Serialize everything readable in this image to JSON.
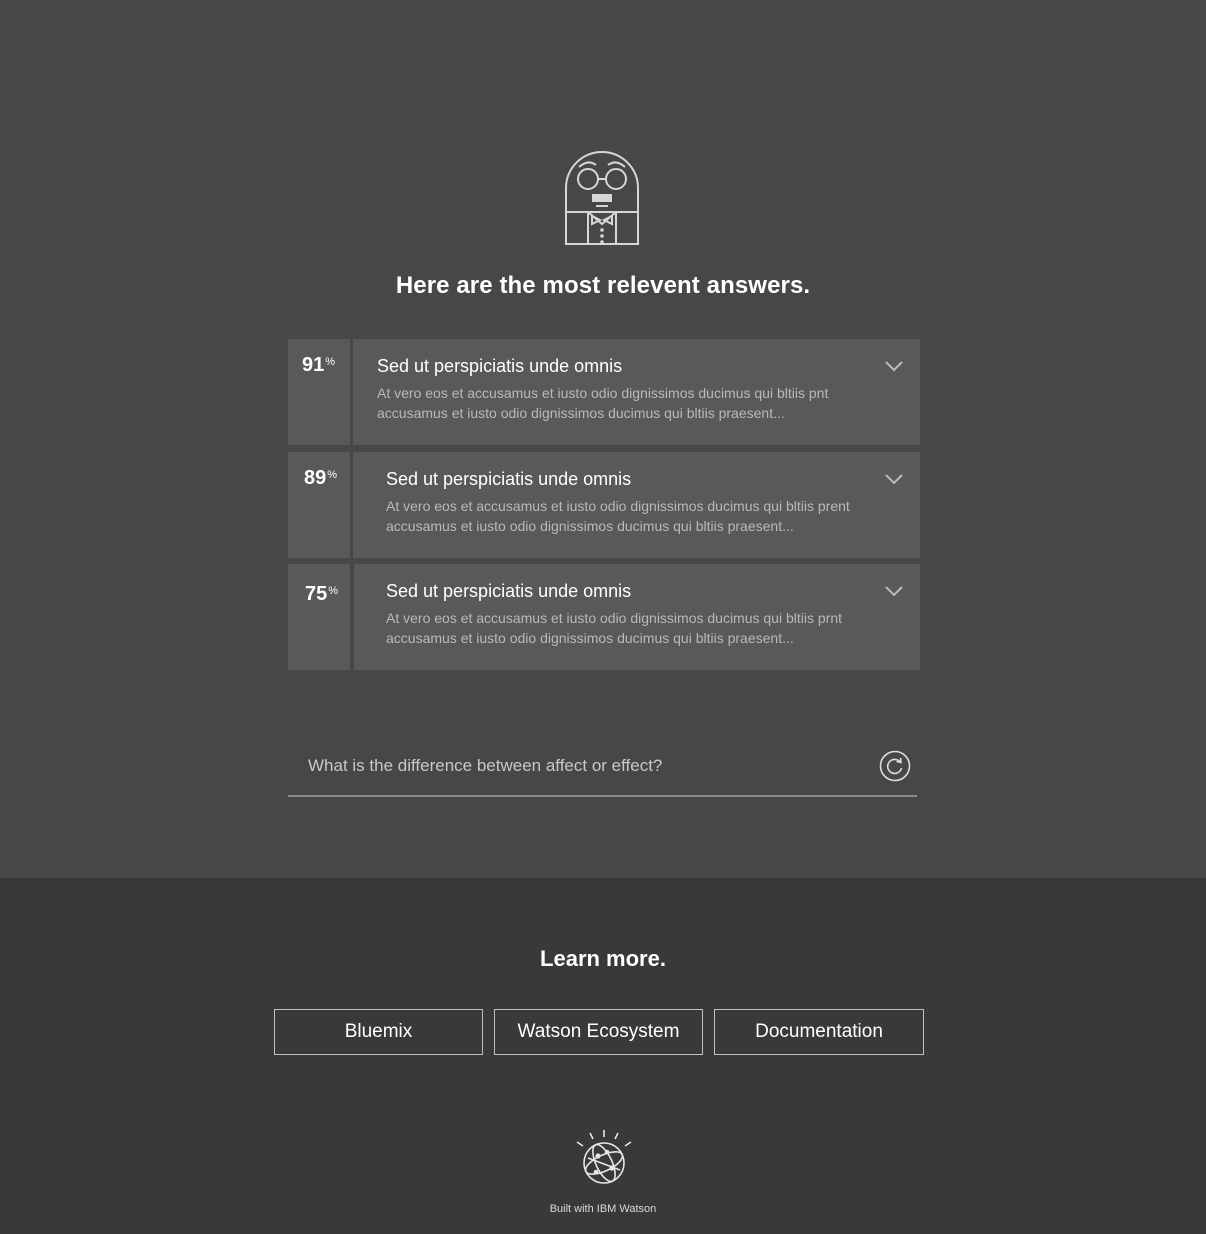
{
  "header": {
    "mascot_icon": "robot-butler-icon",
    "headline": "Here are the most relevent answers."
  },
  "answers": [
    {
      "score": "91",
      "score_unit": "%",
      "title": "Sed ut perspiciatis unde omnis",
      "body_line1": "At vero eos et accusamus et iusto odio dignissimos ducimus qui bltiis pnt",
      "body_line2": "accusamus et iusto odio dignissimos ducimus qui bltiis praesent..."
    },
    {
      "score": "89",
      "score_unit": "%",
      "title": "Sed ut perspiciatis unde omnis",
      "body_line1": "At vero eos et accusamus et iusto odio dignissimos ducimus qui bltiis prent",
      "body_line2": "accusamus et iusto odio dignissimos ducimus qui bltiis praesent..."
    },
    {
      "score": "75",
      "score_unit": "%",
      "title": "Sed ut perspiciatis unde omnis",
      "body_line1": "At vero eos et accusamus et iusto odio dignissimos ducimus qui bltiis prnt",
      "body_line2": "accusamus et iusto odio dignissimos ducimus qui bltiis praesent..."
    }
  ],
  "query": {
    "value": "What is the difference between affect or effect?",
    "refresh_icon": "refresh-icon"
  },
  "learn_more": {
    "heading": "Learn more.",
    "links": [
      "Bluemix",
      "Watson Ecosystem",
      "Documentation"
    ]
  },
  "footer": {
    "logo_icon": "ibm-watson-logo-icon",
    "built_with": "Built with IBM Watson"
  },
  "colors": {
    "top_bg": "#474747",
    "bottom_bg": "#39393b",
    "card_bg": "#595959"
  }
}
